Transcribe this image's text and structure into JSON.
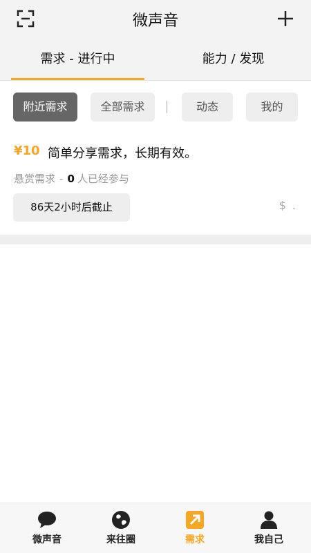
{
  "header": {
    "title": "微声音",
    "scan_icon": "scan-icon",
    "add_icon": "plus-icon"
  },
  "tabs": [
    {
      "label": "需求 - 进行中",
      "active": true
    },
    {
      "label": "能力 / 发现",
      "active": false
    }
  ],
  "filters": [
    {
      "label": "附近需求",
      "active": true
    },
    {
      "label": "全部需求",
      "active": false
    },
    {
      "label": "动态",
      "active": false
    },
    {
      "label": "我的",
      "active": false
    }
  ],
  "listing": {
    "price": "¥10",
    "title": "简单分享需求，长期有效。",
    "type": "悬赏需求",
    "separator": "-",
    "participant_count": "0",
    "participants_text": "人已经参与",
    "deadline": "86天2小时后截止",
    "reward_hint": "$ ."
  },
  "bottom_nav": [
    {
      "label": "微声音",
      "icon": "chat-bubble-icon",
      "active": false
    },
    {
      "label": "来往圈",
      "icon": "globe-icon",
      "active": false
    },
    {
      "label": "需求",
      "icon": "arrow-up-right-icon",
      "active": true
    },
    {
      "label": "我自己",
      "icon": "person-icon",
      "active": false
    }
  ],
  "colors": {
    "accent": "#f5a623",
    "active_chip": "#666666",
    "chip_bg": "#eeeeee",
    "header_bg": "#f3f3f3"
  }
}
